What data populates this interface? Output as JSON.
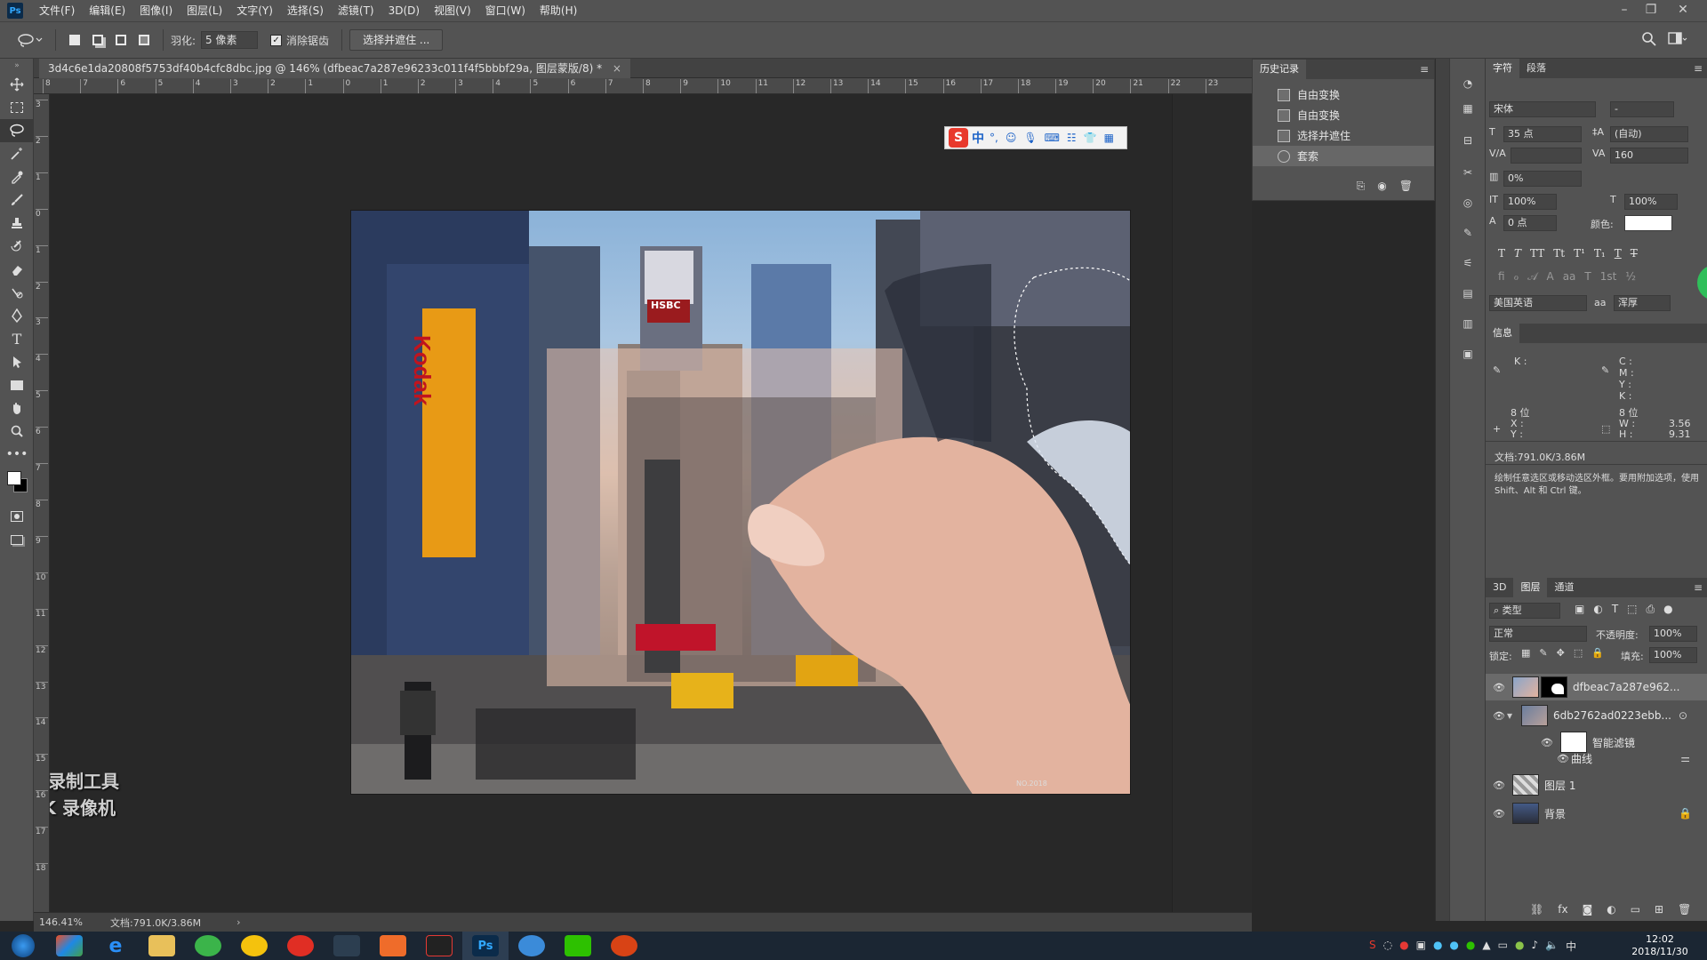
{
  "app": {
    "logo": "Ps",
    "menus": [
      "文件(F)",
      "编辑(E)",
      "图像(I)",
      "图层(L)",
      "文字(Y)",
      "选择(S)",
      "滤镜(T)",
      "3D(D)",
      "视图(V)",
      "窗口(W)",
      "帮助(H)"
    ]
  },
  "options": {
    "feather_label": "羽化:",
    "feather_value": "5 像素",
    "antialias_label": "消除锯齿",
    "select_mask_button": "选择并遮住 ..."
  },
  "document": {
    "tab_title": "3d4c6e1da20808f5753df40b4cfc8dbc.jpg @ 146% (dfbeac7a287e96233c011f4f5bbbf29a, 图层蒙版/8) *",
    "ruler_h_ticks": [
      "8",
      "7",
      "6",
      "5",
      "4",
      "3",
      "2",
      "1",
      "0",
      "1",
      "2",
      "3",
      "4",
      "5",
      "6",
      "7",
      "8",
      "9",
      "10",
      "11",
      "12",
      "13",
      "14",
      "15",
      "16",
      "17",
      "18",
      "19",
      "20",
      "21",
      "22",
      "23"
    ],
    "ruler_v_ticks": [
      "3",
      "2",
      "1",
      "0",
      "1",
      "2",
      "3",
      "4",
      "5",
      "6",
      "7",
      "8",
      "9",
      "10",
      "11",
      "12",
      "13",
      "14",
      "15",
      "16",
      "17",
      "18"
    ]
  },
  "statusbar": {
    "zoom": "146.41%",
    "doc_size": "文档:791.0K/3.86M"
  },
  "history": {
    "title": "历史记录",
    "items": [
      {
        "label": "自由变换"
      },
      {
        "label": "自由变换"
      },
      {
        "label": "选择并遮住"
      },
      {
        "label": "套索"
      }
    ]
  },
  "character": {
    "tab_character": "字符",
    "tab_paragraph": "段落",
    "font_family": "宋体",
    "font_style": "-",
    "font_size": "35 点",
    "leading": "(自动)",
    "tracking": "160",
    "scale_pct": "0%",
    "vscale": "100%",
    "hscale": "100%",
    "baseline": "0 点",
    "color_label": "颜色:",
    "language": "美国英语",
    "aa_mode": "浑厚",
    "aa_label": "aa"
  },
  "info": {
    "title": "信息",
    "k_label": "K :",
    "c_label": "C :",
    "m_label": "M :",
    "y_label": "Y :",
    "k2_label": "K :",
    "bit1": "8 位",
    "bit2": "8 位",
    "x_label": "X :",
    "y2_label": "Y :",
    "w_label": "W :",
    "w_value": "3.56",
    "h_label": "H :",
    "h_value": "9.31",
    "doc": "文档:791.0K/3.86M",
    "hint": "绘制任意选区或移动选区外框。要用附加选项，使用 Shift、Alt 和 Ctrl 键。"
  },
  "layers": {
    "tab_3d": "3D",
    "tab_layers": "图层",
    "tab_channels": "通道",
    "filter_kind": "类型",
    "blend_mode": "正常",
    "opacity_label": "不透明度:",
    "opacity": "100%",
    "lock_label": "锁定:",
    "fill_label": "填充:",
    "fill": "100%",
    "items": [
      {
        "name": "dfbeac7a287e962..."
      },
      {
        "name": "6db2762ad0223ebb..."
      },
      {
        "name": "智能滤镜"
      },
      {
        "name": "曲线"
      },
      {
        "name": "图层 1"
      },
      {
        "name": "背景"
      }
    ]
  },
  "overlay": {
    "watermark_line1": "录制工具",
    "watermark_line2": "KK 录像机",
    "ime_logo": "S",
    "ime_mode": "中",
    "photo_stamp": "NO.2018",
    "ad_sign_1": "HSBC",
    "ad_sign_2": "Kodak"
  },
  "taskbar": {
    "time": "12:02",
    "date": "2018/11/30",
    "ps_label": "Ps"
  },
  "colors": {
    "accent": "#31a8ff",
    "panel": "#535353",
    "canvas_bg": "#282828"
  }
}
